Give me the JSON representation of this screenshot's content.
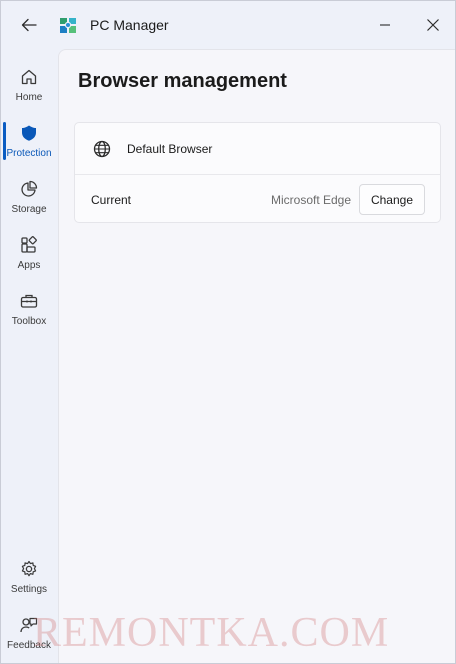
{
  "titlebar": {
    "app_title": "PC Manager",
    "back_icon": "back-arrow-icon",
    "minimize_icon": "minimize-icon",
    "close_icon": "close-icon"
  },
  "nav": {
    "items": [
      {
        "label": "Home",
        "icon": "home-icon",
        "active": false
      },
      {
        "label": "Protection",
        "icon": "shield-icon",
        "active": true
      },
      {
        "label": "Storage",
        "icon": "pie-chart-icon",
        "active": false
      },
      {
        "label": "Apps",
        "icon": "apps-icon",
        "active": false
      },
      {
        "label": "Toolbox",
        "icon": "toolbox-icon",
        "active": false
      }
    ],
    "bottom_items": [
      {
        "label": "Settings",
        "icon": "gear-icon"
      },
      {
        "label": "Feedback",
        "icon": "feedback-icon"
      }
    ]
  },
  "main": {
    "title": "Browser management",
    "card": {
      "header": "Default Browser",
      "header_icon": "globe-icon",
      "row_label": "Current",
      "row_value": "Microsoft Edge",
      "button_label": "Change"
    }
  },
  "watermark": "REMONTKA.COM",
  "colors": {
    "accent": "#0a5cc2",
    "window_bg": "#eef1f9",
    "content_bg": "#f6f6fa"
  }
}
